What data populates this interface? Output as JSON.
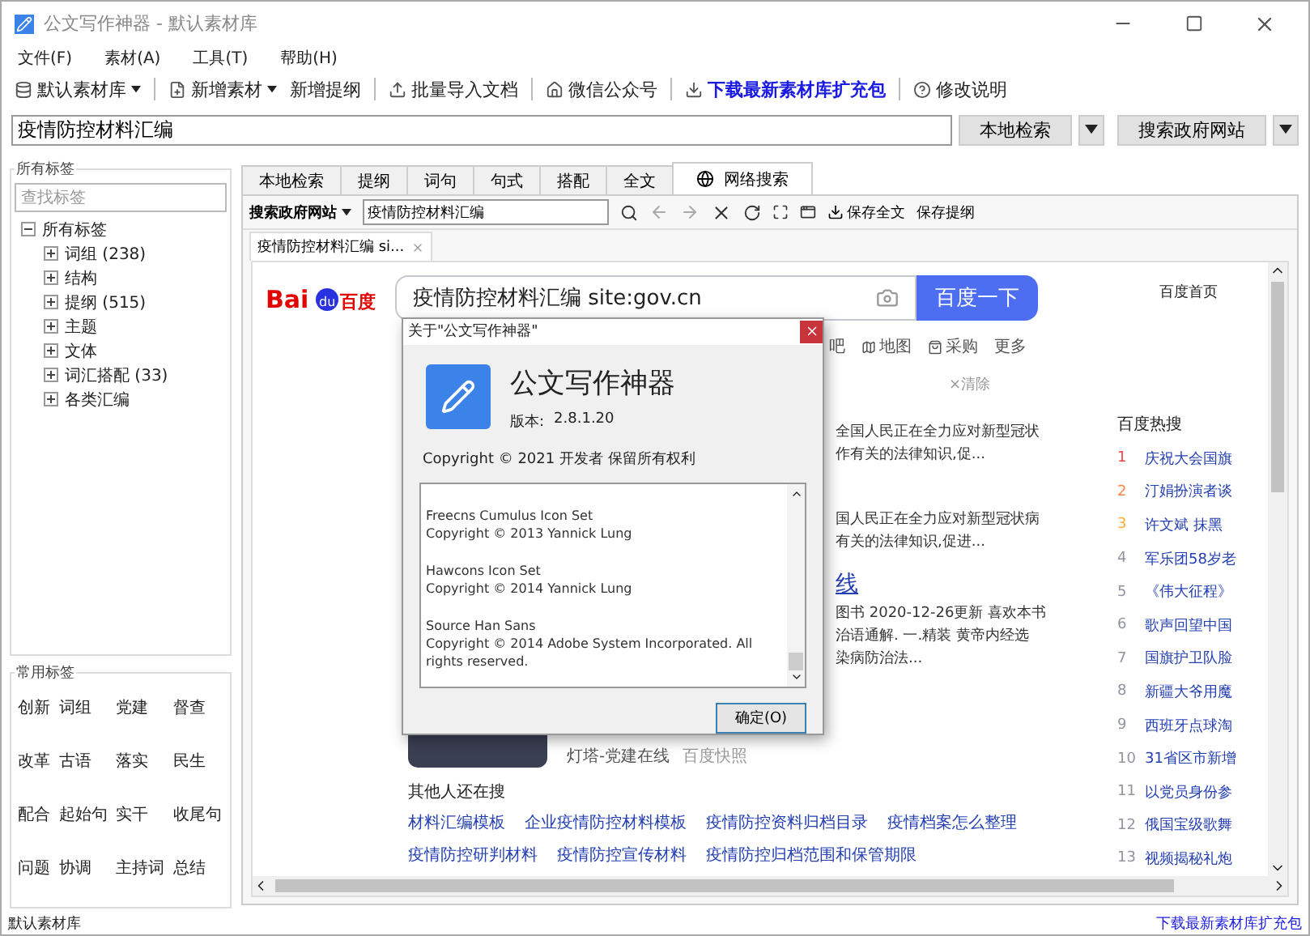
{
  "window": {
    "title": "公文写作神器 - 默认素材库"
  },
  "menu": [
    "文件(F)",
    "素材(A)",
    "工具(T)",
    "帮助(H)"
  ],
  "toolbar": [
    {
      "kind": "dropdown",
      "label": "默认素材库"
    },
    {
      "kind": "dropdown",
      "label": "新增素材"
    },
    {
      "kind": "plain",
      "label": "新增提纲"
    },
    {
      "kind": "plain",
      "label": "批量导入文档"
    },
    {
      "kind": "plain",
      "label": "微信公众号"
    },
    {
      "kind": "highlight",
      "label": "下载最新素材库扩充包"
    },
    {
      "kind": "plain",
      "label": "修改说明"
    }
  ],
  "search": {
    "value": "疫情防控材料汇编",
    "buttons": [
      "本地检索",
      "搜索政府网站"
    ]
  },
  "tag_panel": {
    "title": "所有标签",
    "placeholder": "查找标签",
    "tree": [
      {
        "label": "所有标签",
        "expanded": true,
        "children": [
          {
            "label": "词组",
            "count": "(238)",
            "expanded": false
          },
          {
            "label": "结构",
            "expanded": false
          },
          {
            "label": "提纲",
            "count": "(515)",
            "expanded": false
          },
          {
            "label": "主题",
            "expanded": false
          },
          {
            "label": "文体",
            "expanded": false
          },
          {
            "label": "词汇搭配",
            "count": "(33)",
            "expanded": false
          },
          {
            "label": "各类汇编",
            "expanded": false
          }
        ]
      }
    ]
  },
  "common_tags": {
    "title": "常用标签",
    "tags": [
      "创新",
      "词组",
      "党建",
      "督查",
      "改革",
      "古语",
      "落实",
      "民生",
      "配合",
      "起始句",
      "实干",
      "收尾句",
      "问题",
      "协调",
      "主持词",
      "总结"
    ]
  },
  "tabs": [
    {
      "label": "本地检索",
      "selected": false
    },
    {
      "label": "提纲",
      "selected": false
    },
    {
      "label": "词句",
      "selected": false
    },
    {
      "label": "句式",
      "selected": false
    },
    {
      "label": "搭配",
      "selected": false
    },
    {
      "label": "全文",
      "selected": false
    },
    {
      "label": "网络搜索",
      "selected": true
    }
  ],
  "browser": {
    "engine": "搜索政府网站",
    "address": "疫情防控材料汇编",
    "actions": [
      "保存全文",
      "保存提纲"
    ],
    "page_tab": "疫情防控材料汇编 si..."
  },
  "page": {
    "logo": [
      "Bai",
      "du",
      "百度"
    ],
    "query": "疫情防控材料汇编 site:gov.cn",
    "search_button": "百度一下",
    "home_link": "百度首页",
    "nav": [
      "吧",
      "地图",
      "采购",
      "更多"
    ],
    "clear": "×清除",
    "snippets": [
      {
        "lines": [
          "全国人民正在全力应对新型冠状",
          "作有关的法律知识,促..."
        ]
      },
      {
        "lines": [
          "国人民正在全力应对新型冠状病",
          "有关的法律知识,促进..."
        ]
      },
      {
        "title": "线",
        "lines": [
          "图书 2020-12-26更新 喜欢本书",
          "治语通解. 一.精装 黄帝内经选",
          "染病防治法..."
        ]
      }
    ],
    "source": "灯塔-党建在线",
    "snapshot": "百度快照",
    "related": {
      "title": "其他人还在搜",
      "links": [
        "材料汇编模板",
        "企业疫情防控材料模板",
        "疫情防控资料归档目录",
        "疫情档案怎么整理",
        "疫情防控研判材料",
        "疫情防控宣传材料",
        "疫情防控归档范围和保管期限"
      ]
    },
    "hot": {
      "title": "百度热搜",
      "items": [
        {
          "rank": "1",
          "text": "庆祝大会国旗",
          "color": "#f54545"
        },
        {
          "rank": "2",
          "text": "汀娟扮演者谈",
          "color": "#ff8547"
        },
        {
          "rank": "3",
          "text": "许文斌 抹黑",
          "color": "#ffac38"
        },
        {
          "rank": "4",
          "text": "军乐团58岁老",
          "color": "#9195a3"
        },
        {
          "rank": "5",
          "text": "《伟大征程》",
          "color": "#9195a3"
        },
        {
          "rank": "6",
          "text": "歌声回望中国",
          "color": "#9195a3"
        },
        {
          "rank": "7",
          "text": "国旗护卫队脸",
          "color": "#9195a3"
        },
        {
          "rank": "8",
          "text": "新疆大爷用魔",
          "color": "#9195a3"
        },
        {
          "rank": "9",
          "text": "西班牙点球淘",
          "color": "#9195a3"
        },
        {
          "rank": "10",
          "text": "31省区市新增",
          "color": "#9195a3"
        },
        {
          "rank": "11",
          "text": "以党员身份参",
          "color": "#9195a3"
        },
        {
          "rank": "12",
          "text": "俄国宝级歌舞",
          "color": "#9195a3"
        },
        {
          "rank": "13",
          "text": "视频揭秘礼炮",
          "color": "#9195a3"
        }
      ]
    }
  },
  "dialog": {
    "title": "关于\"公文写作神器\"",
    "app_name": "公文写作神器",
    "version_label": "版本:",
    "version": "2.8.1.20",
    "copyright": "Copyright © 2021  开发者 保留所有权利",
    "credits": [
      [
        "Freecns Cumulus Icon Set",
        "Copyright © 2013 Yannick Lung"
      ],
      [
        "Hawcons Icon Set",
        "Copyright © 2014 Yannick Lung"
      ],
      [
        "Source Han Sans",
        "Copyright © 2014 Adobe System Incorporated. All rights reserved."
      ]
    ],
    "ok": "确定(O)"
  },
  "status_bar": {
    "left": "默认素材库",
    "right": "下载最新素材库扩充包"
  }
}
